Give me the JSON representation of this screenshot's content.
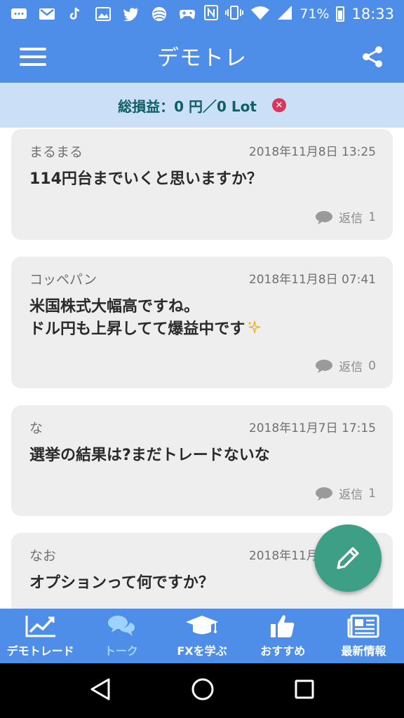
{
  "status_bar": {
    "battery_percent": "71%",
    "time": "18:33"
  },
  "app_bar": {
    "title": "デモトレ"
  },
  "pnl": {
    "label": "総損益：0 円／0 Lot"
  },
  "posts": [
    {
      "author": "まるまる",
      "time": "2018年11月8日 13:25",
      "body": "114円台までいくと思いますか？",
      "reply_label": "返信",
      "reply_count": "1"
    },
    {
      "author": "コッペパン",
      "time": "2018年11月8日 07:41",
      "body": "米国株式大幅高ですね。\nドル円も上昇してて爆益中です",
      "reply_label": "返信",
      "reply_count": "0"
    },
    {
      "author": "な",
      "time": "2018年11月7日 17:15",
      "body": "選挙の結果は?まだトレードないな",
      "reply_label": "返信",
      "reply_count": "1"
    },
    {
      "author": "なお",
      "time": "2018年11月7日 17:45",
      "body": "オプションって何ですか？"
    }
  ],
  "bottom_nav": [
    {
      "label": "デモトレード",
      "icon": "chart-icon"
    },
    {
      "label": "トーク",
      "icon": "chat-icon"
    },
    {
      "label": "FXを学ぶ",
      "icon": "graduation-cap-icon"
    },
    {
      "label": "おすすめ",
      "icon": "thumbs-up-icon"
    },
    {
      "label": "最新情報",
      "icon": "newspaper-icon"
    }
  ],
  "colors": {
    "primary": "#4e8ee8",
    "pnl_bg": "#cbdff7",
    "pnl_text": "#0e5f66",
    "fab": "#3c9f86",
    "active_tab": "#9fd3ff",
    "card_bg": "#eeeeee"
  }
}
